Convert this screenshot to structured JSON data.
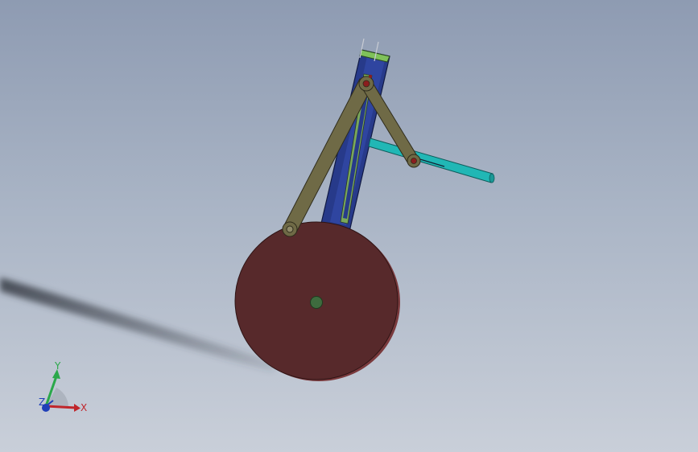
{
  "viewport": {
    "background_top": "#8e9bb2",
    "background_bottom": "#c9cfd9"
  },
  "model": {
    "disk_color": "#57292b",
    "disk_rim_color": "#7a3a3d",
    "hub_color": "#3e6b3e",
    "link_color": "#6f6a46",
    "slider_frame_color": "#273a8a",
    "slider_inner_color": "#7aa85a",
    "top_cap_color": "#7fc15a",
    "rod_color": "#21b7b5",
    "pin_color": "#8b1e1e"
  },
  "triad": {
    "x_label": "X",
    "y_label": "Y",
    "z_label": "Z",
    "x_color": "#c0262b",
    "y_color": "#2aa84a",
    "z_color": "#1f3fb8"
  }
}
